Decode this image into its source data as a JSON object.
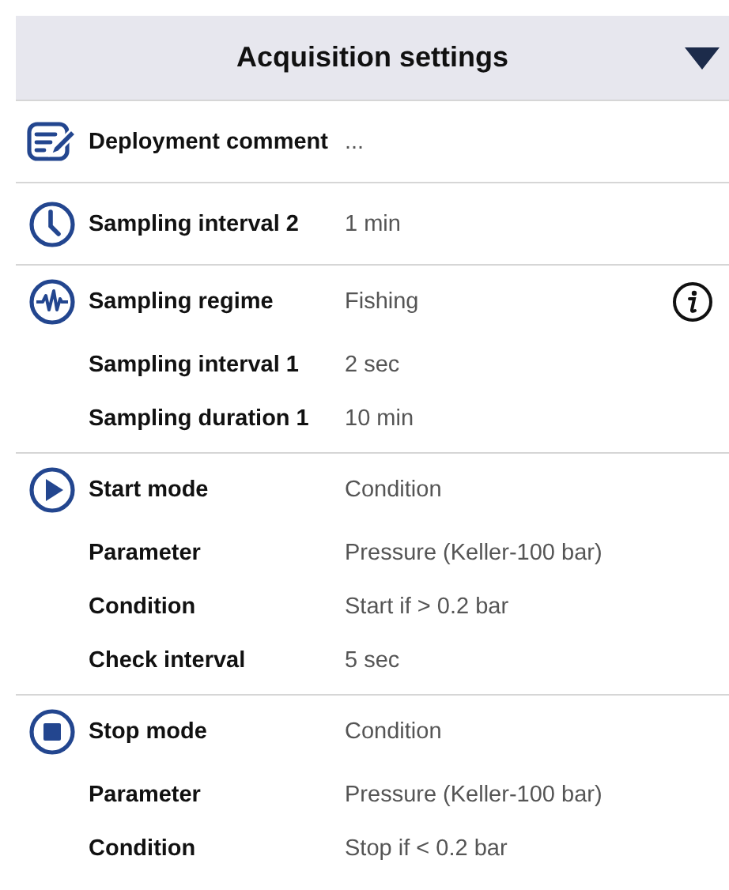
{
  "header": {
    "title": "Acquisition settings",
    "expanded": true
  },
  "sections": [
    {
      "kind": "comment",
      "label": "Deployment comment",
      "value": "...",
      "info": false
    },
    {
      "kind": "clock",
      "label": "Sampling interval 2",
      "value": "1 min",
      "info": false
    },
    {
      "kind": "waveform",
      "label": "Sampling regime",
      "value": "Fishing",
      "info": true,
      "rows": [
        {
          "label": "Sampling interval 1",
          "value": "2 sec"
        },
        {
          "label": "Sampling duration 1",
          "value": "10 min"
        }
      ]
    },
    {
      "kind": "play",
      "label": "Start mode",
      "value": "Condition",
      "info": false,
      "rows": [
        {
          "label": "Parameter",
          "value": "Pressure (Keller-100 bar)"
        },
        {
          "label": "Condition",
          "value": "Start if > 0.2 bar"
        },
        {
          "label": "Check interval",
          "value": "5 sec"
        }
      ]
    },
    {
      "kind": "stop",
      "label": "Stop mode",
      "value": "Condition",
      "info": false,
      "rows": [
        {
          "label": "Parameter",
          "value": "Pressure (Keller-100 bar)"
        },
        {
          "label": "Condition",
          "value": "Stop if < 0.2 bar"
        }
      ]
    }
  ]
}
